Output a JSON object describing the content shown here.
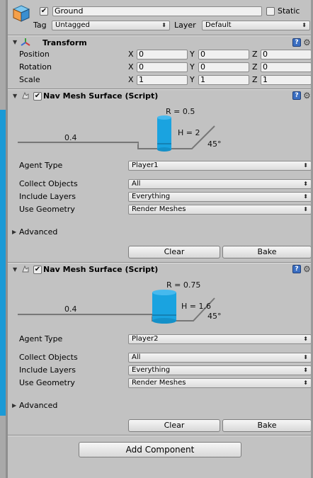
{
  "header": {
    "object_active": true,
    "object_name": "Ground",
    "static_label": "Static",
    "static_checked": false,
    "tag_label": "Tag",
    "tag_value": "Untagged",
    "layer_label": "Layer",
    "layer_value": "Default"
  },
  "transform": {
    "title": "Transform",
    "rows": [
      {
        "label": "Position",
        "x": "0",
        "y": "0",
        "z": "0"
      },
      {
        "label": "Rotation",
        "x": "0",
        "y": "0",
        "z": "0"
      },
      {
        "label": "Scale",
        "x": "1",
        "y": "1",
        "z": "1"
      }
    ],
    "axis_labels": [
      "X",
      "Y",
      "Z"
    ]
  },
  "navmesh": [
    {
      "title": "Nav Mesh Surface (Script)",
      "enabled": true,
      "diagram": {
        "radius": "R = 0.5",
        "height": "H = 2",
        "step": "0.4",
        "slope": "45°"
      },
      "agent_type_label": "Agent Type",
      "agent_type": "Player1",
      "collect_objects_label": "Collect Objects",
      "collect_objects": "All",
      "include_layers_label": "Include Layers",
      "include_layers": "Everything",
      "use_geometry_label": "Use Geometry",
      "use_geometry": "Render Meshes",
      "advanced_label": "Advanced",
      "clear_label": "Clear",
      "bake_label": "Bake"
    },
    {
      "title": "Nav Mesh Surface (Script)",
      "enabled": true,
      "diagram": {
        "radius": "R = 0.75",
        "height": "H = 1.6",
        "step": "0.4",
        "slope": "45°"
      },
      "agent_type_label": "Agent Type",
      "agent_type": "Player2",
      "collect_objects_label": "Collect Objects",
      "collect_objects": "All",
      "include_layers_label": "Include Layers",
      "include_layers": "Everything",
      "use_geometry_label": "Use Geometry",
      "use_geometry": "Render Meshes",
      "advanced_label": "Advanced",
      "clear_label": "Clear",
      "bake_label": "Bake"
    }
  ],
  "add_component_label": "Add Component",
  "colors": {
    "agent_cylinder": "#1aa3e0",
    "script_icon": "#3b6fc2"
  }
}
